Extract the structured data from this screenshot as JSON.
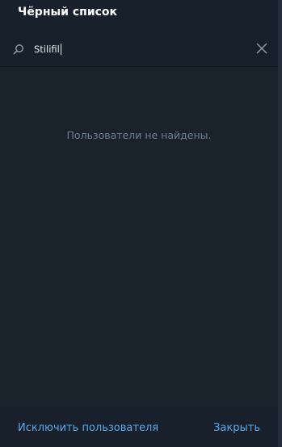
{
  "dialog": {
    "title": "Чёрный список"
  },
  "search": {
    "value": "Stilifil",
    "search_icon": "search-icon",
    "clear_icon": "close-icon"
  },
  "list": {
    "empty_message": "Пользователи не найдены."
  },
  "footer": {
    "exclude_label": "Исключить пользователя",
    "close_label": "Закрыть"
  },
  "colors": {
    "background": "#18212b",
    "accent": "#5aa8ea",
    "muted_text": "#6e7f92",
    "title_text": "#ffffff"
  }
}
